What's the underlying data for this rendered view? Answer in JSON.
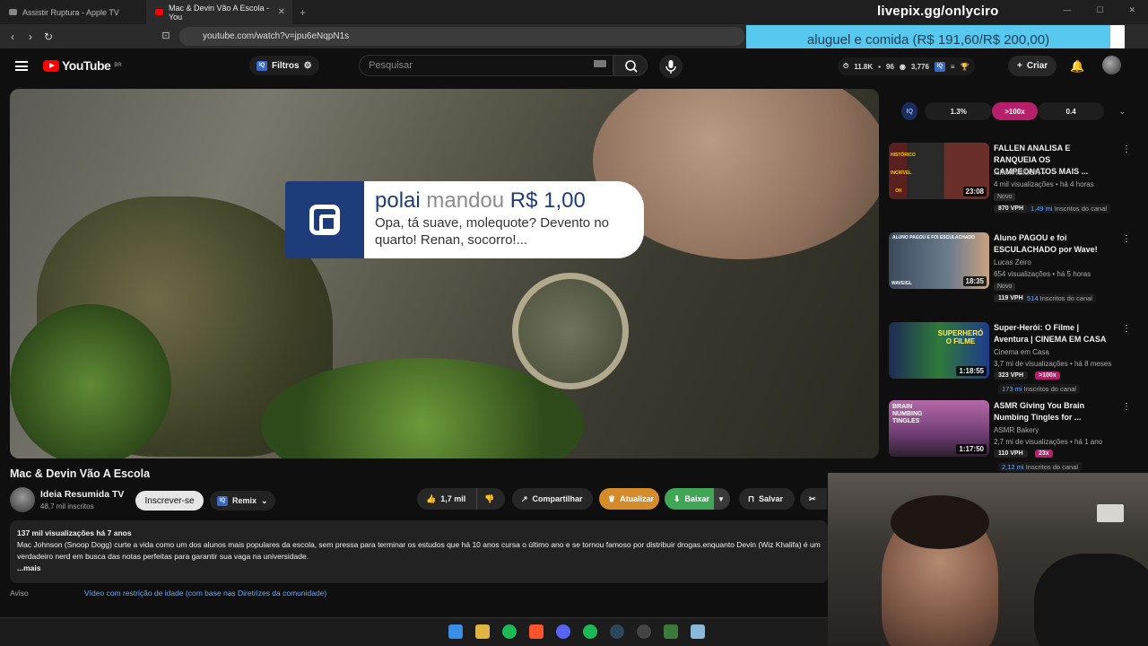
{
  "browser": {
    "tabs": [
      {
        "label": "Assistir Ruptura - Apple TV",
        "active": false
      },
      {
        "label": "Mac & Devin Vão A Escola - You",
        "active": true
      }
    ],
    "new_tab": "+",
    "url": "youtube.com/watch?v=jpu6eNqpN1s"
  },
  "overlay": {
    "stream_url": "livepix.gg/onlyciro",
    "donation_goal": "aluguel e comida (R$ 191,60/R$ 200,00)",
    "notification": {
      "donor": "polai",
      "verb": "mandou",
      "amount": "R$ 1,00",
      "message": "Opa, tá suave, molequote? Devento no quarto! Renan, socorro!..."
    }
  },
  "header": {
    "logo_text": "YouTube",
    "region": "BR",
    "filters_label": "Filtros",
    "search_placeholder": "Pesquisar",
    "stats": {
      "likes": "11.8K",
      "comments": "96",
      "views": "3,776"
    },
    "create_label": "Criar"
  },
  "video": {
    "title": "Mac & Devin Vão A Escola",
    "channel": "Ideia Resumida TV",
    "subscribers": "48,7 mil inscritos",
    "subscribe_label": "Inscrever-se",
    "remix_label": "Remix",
    "likes": "1,7 mil",
    "share_label": "Compartilhar",
    "update_label": "Atualizar",
    "download_label": "Baixar",
    "save_label": "Salvar",
    "description": {
      "meta": "137 mil visualizações  há 7 anos",
      "text": "Mac Johnson (Snoop Dogg) curte a vida como um dos alunos mais populares da escola, sem pressa para terminar os estudos que há 10 anos cursa o último ano e se tornou famoso por distribuir drogas.enquanto Devin (Wiz Khalifa) é um verdadeiro nerd em busca das notas perfeitas para garantir sua vaga na universidade.",
      "more": "...mais"
    },
    "warning_label": "Aviso",
    "warning_link": "Vídeo com restrição de idade (com base nas Diretrizes da comunidade)"
  },
  "iq_bar": {
    "badge": "IQ",
    "left": "1.3%",
    "middle": ">100x",
    "right": "0.4"
  },
  "recommendations": [
    {
      "title": "FALLEN ANALISA E RANQUEIA OS CAMPEONATOS MAIS ...",
      "channel": "fallenINSIDER",
      "views": "4 mil visualizações",
      "age": "há 4 horas",
      "duration": "23:08",
      "badge": "Novo",
      "vph": "870 VPH",
      "subs_count": "1,49 mi",
      "subs_label": "Inscritos do canal",
      "multiplier": "",
      "thumb_color": "#3b2a26",
      "thumb_text": [
        "HISTÓRICO",
        "INCRÍVEL",
        "OK"
      ]
    },
    {
      "title": "Aluno PAGOU e foi ESCULACHADO por Wave!",
      "channel": "Lucas Zeiro",
      "views": "654 visualizações",
      "age": "há 5 horas",
      "duration": "18:35",
      "badge": "Novo",
      "vph": "119 VPH",
      "subs_count": "514",
      "subs_label": "Inscritos do canal",
      "multiplier": "",
      "thumb_color": "#4d5a6b",
      "thumb_text": [
        "ALUNO PAGOU E FOI ESCULACHADO",
        "WAVEIGL"
      ]
    },
    {
      "title": "Super-Herói: O Filme | Aventura | CINEMA EM CASA",
      "channel": "Cinema em Casa",
      "views": "3,7 mi de visualizações",
      "age": "há 8 meses",
      "duration": "1:18:55",
      "badge": "",
      "vph": "323 VPH",
      "subs_count": "173 mi",
      "subs_label": "Inscritos do canal",
      "multiplier": ">100x",
      "thumb_color": "#1e3a8a",
      "thumb_text": [
        "SUPERHERÓ O FILME"
      ]
    },
    {
      "title": "ASMR Giving You Brain Numbing Tingles for ...",
      "channel": "ASMR Bakery",
      "views": "2,7 mi de visualizações",
      "age": "há 1 ano",
      "duration": "1:17:50",
      "badge": "",
      "vph": "110 VPH",
      "subs_count": "2,12 mi",
      "subs_label": "Inscritos do canal",
      "multiplier": "23x",
      "thumb_color": "#7a3f7a",
      "thumb_text": [
        "BRAIN NUMBING TINGLES"
      ]
    }
  ]
}
